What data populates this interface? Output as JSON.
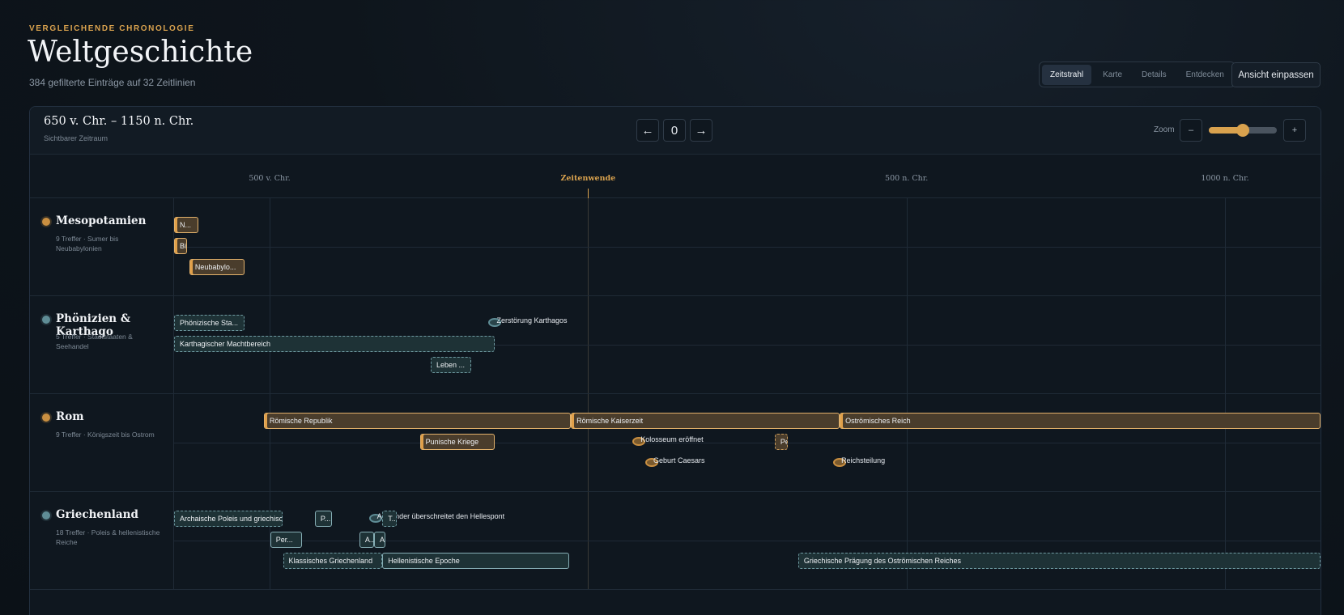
{
  "header": {
    "eyebrow": "VERGLEICHENDE CHRONOLOGIE",
    "title": "Weltgeschichte",
    "subtitle": "384 gefilterte Einträge auf 32 Zeitlinien"
  },
  "view_tabs": [
    {
      "label": "Zeitstrahl",
      "active": true
    },
    {
      "label": "Karte",
      "active": false
    },
    {
      "label": "Details",
      "active": false
    },
    {
      "label": "Entdecken",
      "active": false
    }
  ],
  "fit_button": "Ansicht einpassen",
  "toolbar": {
    "range": "650 v. Chr. – 1150 n. Chr.",
    "range_caption": "Sichtbarer Zeitraum",
    "prev": "←",
    "offset": "0",
    "next": "→",
    "zoom_label": "Zoom",
    "zoom_minus": "–",
    "zoom_plus": "+",
    "zoom_level": 0.5
  },
  "axis": {
    "start_year": -650,
    "end_year": 1150,
    "ticks": [
      {
        "label": "500 v. Chr.",
        "year": -500,
        "era": false
      },
      {
        "label": "Zeitenwende",
        "year": 0,
        "era": true
      },
      {
        "label": "500 n. Chr.",
        "year": 500,
        "era": false
      },
      {
        "label": "1000 n. Chr.",
        "year": 1000,
        "era": false
      }
    ]
  },
  "colors": {
    "gold": "#d9a24e",
    "teal": "#6f9aa2"
  },
  "lanes": [
    {
      "name": "Mesopotamien",
      "meta": "9 Treffer · Sumer bis Neubabylonien",
      "color": "#c98f41",
      "items": [
        {
          "label": "N...",
          "kind": "bar",
          "style": "gold strong",
          "start": -650,
          "end": -612,
          "row": 0
        },
        {
          "label": "Bi",
          "kind": "bar",
          "style": "gold strong",
          "start": -650,
          "end": -630,
          "row": 1
        },
        {
          "label": "Neubabylo...",
          "kind": "bar",
          "style": "gold strong",
          "start": -626,
          "end": -539,
          "row": 2
        }
      ]
    },
    {
      "name": "Phönizien & Karthago",
      "meta": "5 Treffer · Stadtstaaten & Seehandel",
      "color": "#5f8d96",
      "items": [
        {
          "label": "Phönizische Sta...",
          "kind": "bar",
          "style": "teal",
          "start": -650,
          "end": -539,
          "row": 0
        },
        {
          "label": "Zerstörung Karthagos",
          "kind": "event",
          "style": "teal",
          "start": -146,
          "row": 0
        },
        {
          "label": "Karthagischer Machtbereich",
          "kind": "bar",
          "style": "teal",
          "start": -650,
          "end": -146,
          "row": 1
        },
        {
          "label": "Leben ...",
          "kind": "bar",
          "style": "teal",
          "start": -247,
          "end": -183,
          "row": 2
        }
      ]
    },
    {
      "name": "Rom",
      "meta": "9 Treffer · Königszeit bis Ostrom",
      "color": "#c98f41",
      "items": [
        {
          "label": "Römische Republik",
          "kind": "bar",
          "style": "gold strong",
          "start": -509,
          "end": -27,
          "row": 0
        },
        {
          "label": "Römische Kaiserzeit",
          "kind": "bar",
          "style": "gold strong",
          "start": -27,
          "end": 395,
          "row": 0
        },
        {
          "label": "Oströmisches Reich",
          "kind": "bar",
          "style": "gold strong",
          "start": 395,
          "end": 1150,
          "row": 0
        },
        {
          "label": "Punische Kriege",
          "kind": "bar",
          "style": "gold strong",
          "start": -264,
          "end": -146,
          "row": 1
        },
        {
          "label": "Kolosseum eröffnet",
          "kind": "event",
          "style": "gold",
          "start": 80,
          "row": 1
        },
        {
          "label": "Pe",
          "kind": "bar",
          "style": "gold dashed",
          "start": 293,
          "end": 313,
          "row": 1
        },
        {
          "label": "Geburt Caesars",
          "kind": "event",
          "style": "gold",
          "start": 100,
          "row": 2,
          "negative": true
        },
        {
          "label": "Reichsteilung",
          "kind": "event",
          "style": "gold",
          "start": 395,
          "row": 2
        }
      ]
    },
    {
      "name": "Griechenland",
      "meta": "18 Treffer · Poleis & hellenistische Reiche",
      "color": "#5f8d96",
      "items": [
        {
          "label": "Archaische Poleis und griechische Kolonisation",
          "kind": "bar",
          "style": "teal",
          "start": -650,
          "end": -480,
          "row": 0
        },
        {
          "label": "P...",
          "kind": "bar",
          "style": "teal solid",
          "start": -429,
          "end": -402,
          "row": 0
        },
        {
          "label": "Alexander überschreitet den Hellespont",
          "kind": "event",
          "style": "teal",
          "start": -334,
          "row": 0
        },
        {
          "label": "T...",
          "kind": "bar",
          "style": "teal",
          "start": -323,
          "end": -301,
          "row": 0
        },
        {
          "label": "Per...",
          "kind": "bar",
          "style": "teal solid",
          "start": -499,
          "end": -449,
          "row": 1
        },
        {
          "label": "A...",
          "kind": "bar",
          "style": "teal solid",
          "start": -359,
          "end": -336,
          "row": 1
        },
        {
          "label": "A",
          "kind": "bar",
          "style": "teal solid",
          "start": -336,
          "end": -323,
          "row": 1
        },
        {
          "label": "Klassisches Griechenland",
          "kind": "bar",
          "style": "teal",
          "start": -479,
          "end": -323,
          "row": 2
        },
        {
          "label": "Hellenistische Epoche",
          "kind": "bar",
          "style": "teal solid",
          "start": -323,
          "end": -30,
          "row": 2
        },
        {
          "label": "Griechische Prägung des Oströmischen Reiches",
          "kind": "bar",
          "style": "teal",
          "start": 330,
          "end": 1150,
          "row": 2
        }
      ]
    }
  ]
}
